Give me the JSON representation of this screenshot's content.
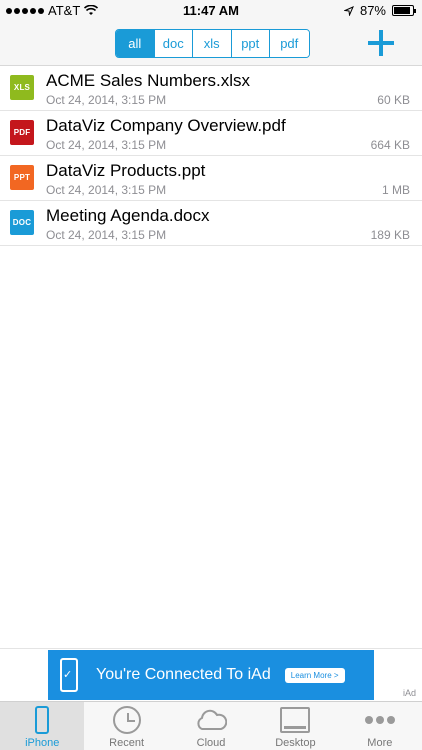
{
  "status": {
    "carrier": "AT&T",
    "time": "11:47 AM",
    "battery": "87%",
    "battery_level": 0.87
  },
  "filter": {
    "segments": [
      "all",
      "doc",
      "xls",
      "ppt",
      "pdf"
    ],
    "selected": "all"
  },
  "toolbar": {
    "add_icon": "plus-icon"
  },
  "files": [
    {
      "name": "ACME Sales Numbers.xlsx",
      "date": "Oct 24, 2014, 3:15 PM",
      "size": "60 KB",
      "type": "XLS",
      "color": "#8fba1e"
    },
    {
      "name": "DataViz Company Overview.pdf",
      "date": "Oct 24, 2014, 3:15 PM",
      "size": "664 KB",
      "type": "PDF",
      "color": "#c4161c"
    },
    {
      "name": "DataViz Products.ppt",
      "date": "Oct 24, 2014, 3:15 PM",
      "size": "1 MB",
      "type": "PPT",
      "color": "#f26722"
    },
    {
      "name": "Meeting Agenda.docx",
      "date": "Oct 24, 2014, 3:15 PM",
      "size": "189 KB",
      "type": "DOC",
      "color": "#1a9bd7"
    }
  ],
  "ad": {
    "text": "You're Connected To iAd",
    "button": "Learn More >",
    "tag": "iAd"
  },
  "tabs": [
    {
      "label": "iPhone",
      "icon": "iphone-icon",
      "active": true
    },
    {
      "label": "Recent",
      "icon": "clock-icon",
      "active": false
    },
    {
      "label": "Cloud",
      "icon": "cloud-icon",
      "active": false
    },
    {
      "label": "Desktop",
      "icon": "desktop-icon",
      "active": false
    },
    {
      "label": "More",
      "icon": "more-icon",
      "active": false
    }
  ],
  "colors": {
    "accent": "#1a9bd7",
    "ad_blue": "#1a8fe0"
  }
}
